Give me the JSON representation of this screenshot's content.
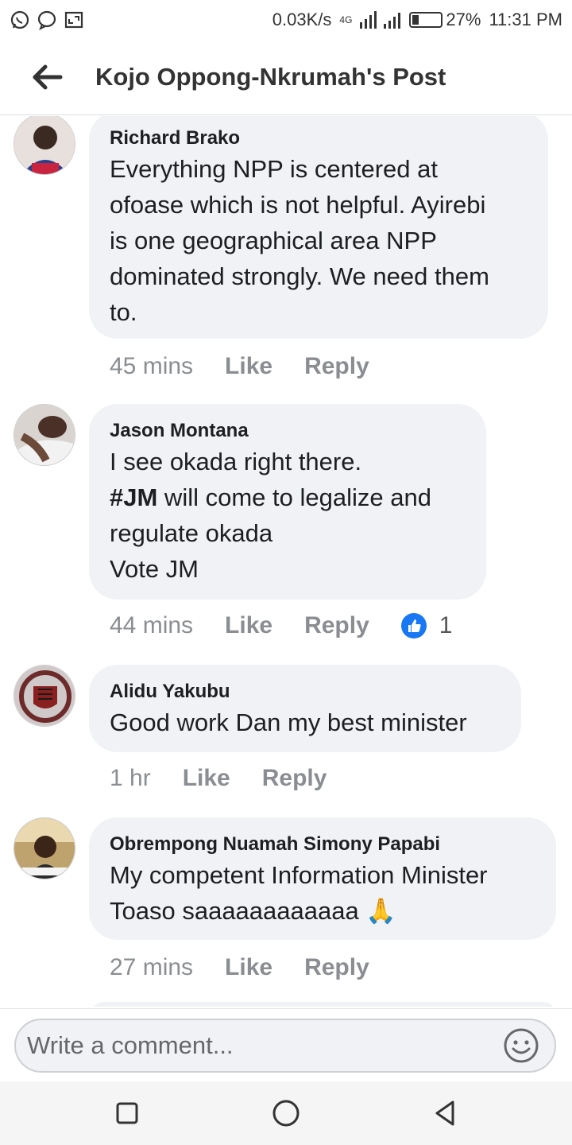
{
  "status_bar": {
    "network_speed": "0.03K/s",
    "network_type": "4G",
    "battery_percent": "27%",
    "time": "11:31 PM"
  },
  "header": {
    "title": "Kojo Oppong-Nkrumah's Post"
  },
  "comments": [
    {
      "author": "Richard Brako",
      "lines": [
        "Everything NPP is centered at",
        "ofoase which is not helpful. Ayirebi",
        "is one geographical area NPP",
        "dominated strongly. We need them",
        "to."
      ],
      "time": "45 mins",
      "like_label": "Like",
      "reply_label": "Reply"
    },
    {
      "author": "Jason Montana",
      "line1": "I see okada right there.",
      "line2_hashtag": "#JM",
      "line2_rest": " will come to legalize and",
      "line3": "regulate okada",
      "line4": "Vote JM",
      "time": "44 mins",
      "like_label": "Like",
      "reply_label": "Reply",
      "reaction_count": "1"
    },
    {
      "author": "Alidu Yakubu",
      "text": "Good work Dan my best minister",
      "time": "1 hr",
      "like_label": "Like",
      "reply_label": "Reply"
    },
    {
      "author": "Obrempong Nuamah Simony Papabi",
      "line1": "My competent Information Minister",
      "line2": "Toaso saaaaaaaaaaaa",
      "emoji": "🙏",
      "time": "27 mins",
      "like_label": "Like",
      "reply_label": "Reply"
    }
  ],
  "composer": {
    "placeholder": "Write a comment..."
  },
  "icons": {
    "back": "arrow-left-icon",
    "emoji": "smiley-icon",
    "like_reaction": "thumbs-up-icon",
    "nav_recent": "square-icon",
    "nav_home": "circle-icon",
    "nav_back": "triangle-back-icon"
  },
  "colors": {
    "facebook_blue": "#1877f2",
    "bubble_bg": "#f0f2f5",
    "meta_gray": "#8a8d91"
  }
}
